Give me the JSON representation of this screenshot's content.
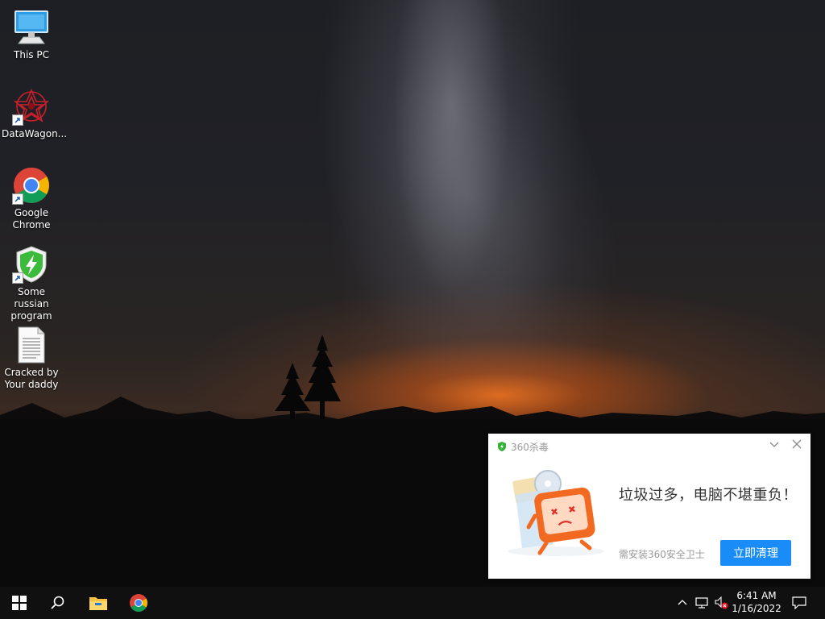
{
  "desktop": {
    "icons": [
      {
        "label": "This PC",
        "icon": "this-pc-icon"
      },
      {
        "label": "DataWagon...",
        "icon": "datawagon-icon"
      },
      {
        "label": "Google Chrome",
        "icon": "chrome-icon"
      },
      {
        "label": "Some russian program",
        "icon": "shield-bolt-icon"
      },
      {
        "label": "Cracked by Your daddy",
        "icon": "text-document-icon"
      }
    ]
  },
  "popup": {
    "app_name": "360杀毒",
    "message": "垃圾过多，电脑不堪重负！",
    "note": "需安装360安全卫士",
    "button_label": "立即清理",
    "accent": "#1a8cf7"
  },
  "taskbar": {
    "start_icon": "windows-start-icon",
    "search_icon": "search-icon",
    "pinned": [
      "file-explorer-icon",
      "chrome-icon"
    ],
    "tray": [
      "chevron-up-icon",
      "network-icon",
      "volume-muted-icon"
    ],
    "time": "6:41 AM",
    "date": "1/16/2022",
    "notifications_icon": "notification-icon"
  }
}
